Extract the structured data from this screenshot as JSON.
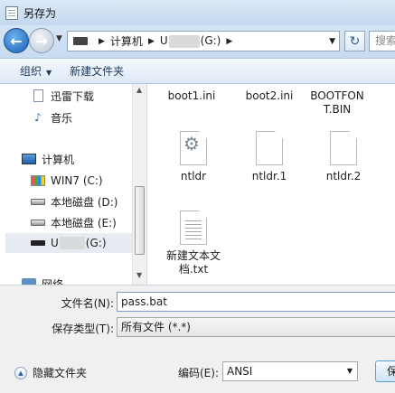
{
  "window": {
    "title": "另存为"
  },
  "address": {
    "crumbs": [
      "计算机",
      "U",
      "(G:)"
    ],
    "search_placeholder": "搜索"
  },
  "toolbar": {
    "organize": "组织",
    "new_folder": "新建文件夹"
  },
  "nav": {
    "items": [
      {
        "label": "迅雷下载",
        "icon": "document-icon"
      },
      {
        "label": "音乐",
        "icon": "music-icon"
      },
      {
        "label": "计算机",
        "icon": "computer-icon"
      },
      {
        "label": "WIN7 (C:)",
        "icon": "windows-drive-icon"
      },
      {
        "label": "本地磁盘 (D:)",
        "icon": "disk-icon"
      },
      {
        "label": "本地磁盘 (E:)",
        "icon": "disk-icon"
      },
      {
        "label_pre": "U",
        "label_post": "(G:)",
        "icon": "usb-drive-icon"
      },
      {
        "label": "网络",
        "icon": "network-icon"
      }
    ]
  },
  "files": [
    {
      "name": "boot1.ini"
    },
    {
      "name": "boot2.ini"
    },
    {
      "name": "BOOTFON T.BIN"
    },
    {
      "name": "ntldr"
    },
    {
      "name": "ntldr.1"
    },
    {
      "name": "ntldr.2"
    },
    {
      "name": "新建文本文 档.txt"
    }
  ],
  "form": {
    "filename_label": "文件名(N):",
    "filename_value": "pass.bat",
    "type_label": "保存类型(T):",
    "type_value": "所有文件  (*.*)",
    "hide_folders": "隐藏文件夹",
    "encoding_label": "编码(E):",
    "encoding_value": "ANSI",
    "save_label": "保"
  }
}
